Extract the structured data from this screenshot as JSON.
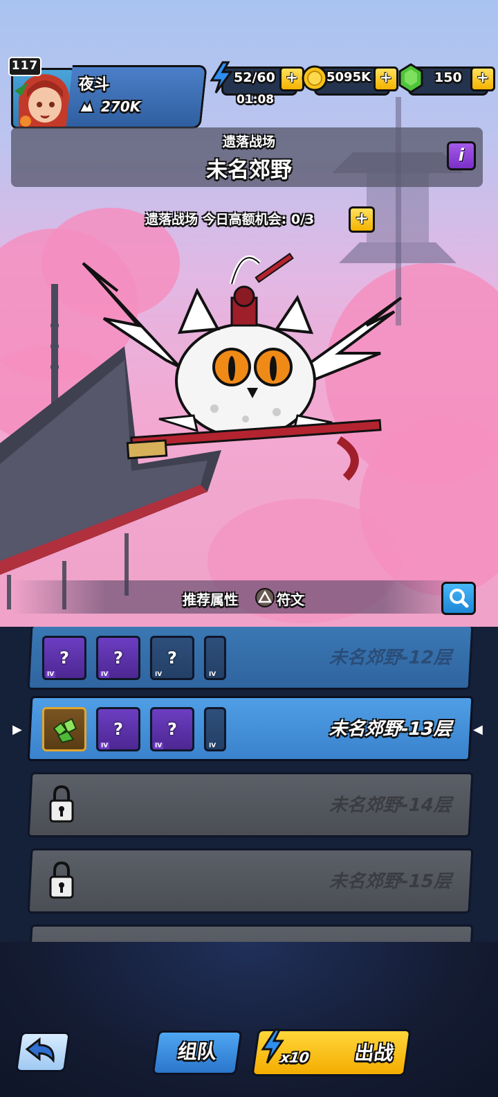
{
  "player": {
    "level": "117",
    "name": "夜斗",
    "power": "270K"
  },
  "resources": {
    "energy": "52/60",
    "energy_timer": "01:08",
    "gold": "5095K",
    "gems": "150",
    "plus_symbol": "+"
  },
  "battlefield": {
    "category": "遗落战场",
    "title": "未名郊野",
    "info_symbol": "i",
    "daily_chance": "遗落战场 今日高额机会: 0/3"
  },
  "recommend": {
    "label": "推荐属性",
    "attribute": "符文"
  },
  "floors": [
    {
      "label": "未名郊野-12层",
      "state": "unlocked"
    },
    {
      "label": "未名郊野-13层",
      "state": "selected"
    },
    {
      "label": "未名郊野-14层",
      "state": "locked"
    },
    {
      "label": "未名郊野-15层",
      "state": "locked"
    }
  ],
  "reward_tier": "IV",
  "unknown_reward": "?",
  "selector_markers": {
    "left": "▶",
    "right": "◀"
  },
  "buttons": {
    "team": "组队",
    "multiplier": "x10",
    "battle": "出战"
  },
  "colors": {
    "accent_yellow": "#f7c21a",
    "panel_blue": "#3a82cc",
    "locked_gray": "#55585f"
  }
}
